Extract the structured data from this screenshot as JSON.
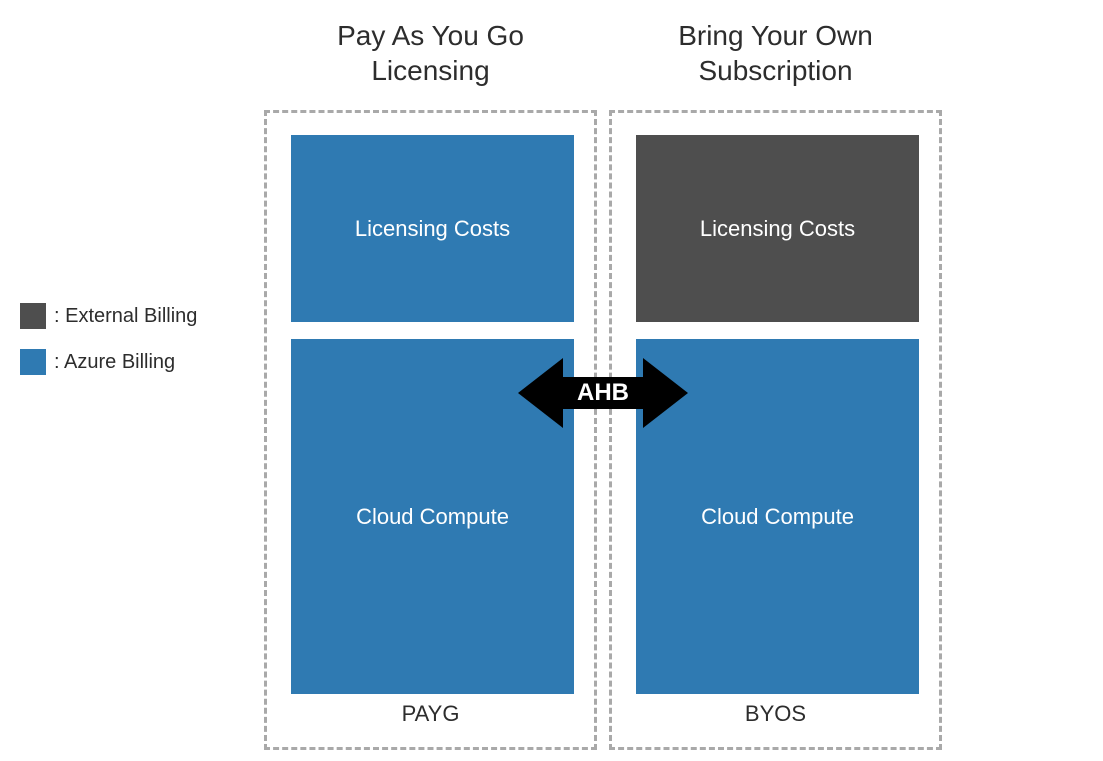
{
  "titles": {
    "left_line1": "Pay As You Go",
    "left_line2": "Licensing",
    "right_line1": "Bring Your Own",
    "right_line2": "Subscription"
  },
  "left": {
    "licensing_label": "Licensing Costs",
    "compute_label": "Cloud Compute",
    "footer": "PAYG",
    "licensing_color": "blue",
    "compute_color": "blue"
  },
  "right": {
    "licensing_label": "Licensing Costs",
    "compute_label": "Cloud Compute",
    "footer": "BYOS",
    "licensing_color": "gray",
    "compute_color": "blue"
  },
  "arrow": {
    "label": "AHB"
  },
  "legend": {
    "items": [
      {
        "color": "#4e4e4e",
        "label": ": External Billing"
      },
      {
        "color": "#2f7ab2",
        "label": ": Azure Billing"
      }
    ]
  },
  "colors": {
    "blue": "#2f7ab2",
    "gray": "#4e4e4e",
    "dash": "#a9a9a9"
  }
}
